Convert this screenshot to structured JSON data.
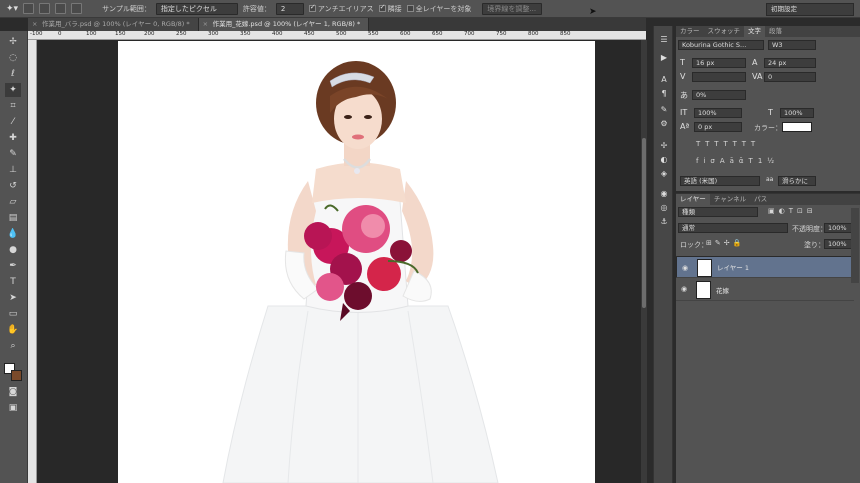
{
  "options_bar": {
    "sample_label": "サンプル範囲：",
    "sample_value": "指定したピクセル",
    "tolerance_label": "許容値：",
    "tolerance_value": "2",
    "antialias_label": "アンチエイリアス",
    "contiguous_label": "隣接",
    "all_layers_label": "全レイヤーを対象",
    "refine_edge_label": "境界線を調整..."
  },
  "workspace_label": "初期設定",
  "document_tabs": [
    {
      "title": "作業用_バラ.psd @ 100% (レイヤー 0, RGB/8) *",
      "active": false
    },
    {
      "title": "作業用_花嫁.psd @ 100% (レイヤー 1, RGB/8) *",
      "active": true
    }
  ],
  "rulers": {
    "top_ticks": [
      "-100",
      "0",
      "100",
      "150",
      "200",
      "250",
      "300",
      "350",
      "400",
      "450",
      "500",
      "550",
      "600",
      "650",
      "700",
      "750",
      "800",
      "850"
    ]
  },
  "character_panel": {
    "tabs": [
      "カラー",
      "スウォッチ",
      "文字",
      "段落"
    ],
    "active_tab": "文字",
    "font_family": "Koburina Gothic S...",
    "font_style": "W3",
    "font_size": "16 px",
    "leading": "24 px",
    "kerning": "",
    "tracking": "0",
    "tsume": "0%",
    "vertical_scale": "100%",
    "horizontal_scale": "100%",
    "baseline_shift": "0 px",
    "color_label": "カラー：",
    "color_value": "#ffffff",
    "language": "英語 (米国)",
    "antialias": "滑らかに"
  },
  "layers_panel": {
    "tabs": [
      "レイヤー",
      "チャンネル",
      "パス"
    ],
    "active_tab": "レイヤー",
    "filter_kind": "種類",
    "blend_mode": "通常",
    "opacity_label": "不透明度：",
    "opacity": "100%",
    "lock_label": "ロック：",
    "fill_label": "塗り：",
    "fill": "100%",
    "layers": [
      {
        "name": "レイヤー 1",
        "selected": true
      },
      {
        "name": "花嫁",
        "selected": false
      }
    ]
  },
  "colors": {
    "accent_selected_layer": "#62738e",
    "panel": "#535353",
    "foreground": "#ffffff",
    "background": "#7a4a2a"
  }
}
